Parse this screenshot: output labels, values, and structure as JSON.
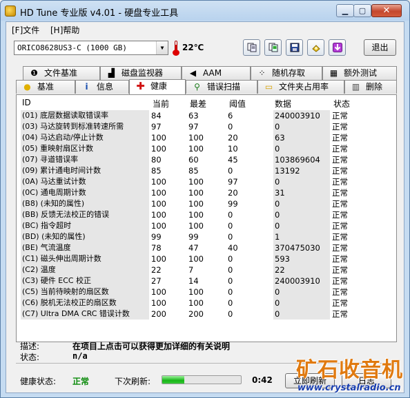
{
  "window": {
    "title": "HD Tune 专业版 v4.01 - 硬盘专业工具",
    "minimize": "▁",
    "maximize": "▢",
    "close": "✕"
  },
  "menu": {
    "file": "[F]文件",
    "help": "[H]帮助"
  },
  "toolbar": {
    "drive": "ORICO8628US3-C (1000 GB)",
    "temperature": "22℃",
    "exit_label": "退出",
    "icons": [
      "copy-text-icon",
      "copy-screen-icon",
      "save-icon",
      "options-icon",
      "download-icon"
    ]
  },
  "tabs_top": [
    {
      "label": "文件基准",
      "icon": "file-benchmark-icon",
      "glyph": "❶"
    },
    {
      "label": "磁盘监视器",
      "icon": "disk-monitor-icon",
      "glyph": "▟"
    },
    {
      "label": "AAM",
      "icon": "speaker-icon",
      "glyph": "◀"
    },
    {
      "label": "随机存取",
      "icon": "random-access-icon",
      "glyph": "⁘"
    },
    {
      "label": "额外测试",
      "icon": "extra-tests-icon",
      "glyph": "▦"
    }
  ],
  "tabs_bottom": [
    {
      "label": "基准",
      "icon": "benchmark-icon",
      "glyph": "●"
    },
    {
      "label": "信息",
      "icon": "info-icon",
      "glyph": "i"
    },
    {
      "label": "健康",
      "icon": "health-cross-icon",
      "glyph": "✚"
    },
    {
      "label": "错误扫描",
      "icon": "error-scan-icon",
      "glyph": "⚲"
    },
    {
      "label": "文件夹占用率",
      "icon": "folder-usage-icon",
      "glyph": "▭"
    },
    {
      "label": "删除",
      "icon": "erase-trash-icon",
      "glyph": "▥"
    }
  ],
  "active_tab": "健康",
  "table": {
    "headers": {
      "id": "ID",
      "current": "当前",
      "worst": "最差",
      "threshold": "阈值",
      "data": "数据",
      "status": "状态"
    },
    "rows": [
      {
        "id": "(01) 底层数据读取错误率",
        "current": "84",
        "worst": "63",
        "threshold": "6",
        "data": "240003910",
        "status": "正常"
      },
      {
        "id": "(03) 马达旋转到标准转速所需",
        "current": "97",
        "worst": "97",
        "threshold": "0",
        "data": "0",
        "status": "正常"
      },
      {
        "id": "(04) 马达启动/停止计数",
        "current": "100",
        "worst": "100",
        "threshold": "20",
        "data": "63",
        "status": "正常"
      },
      {
        "id": "(05) 重映射扇区计数",
        "current": "100",
        "worst": "100",
        "threshold": "10",
        "data": "0",
        "status": "正常"
      },
      {
        "id": "(07) 寻道错误率",
        "current": "80",
        "worst": "60",
        "threshold": "45",
        "data": "103869604",
        "status": "正常"
      },
      {
        "id": "(09) 累计通电时间计数",
        "current": "85",
        "worst": "85",
        "threshold": "0",
        "data": "13192",
        "status": "正常"
      },
      {
        "id": "(0A) 马达重试计数",
        "current": "100",
        "worst": "100",
        "threshold": "97",
        "data": "0",
        "status": "正常"
      },
      {
        "id": "(0C) 通电周期计数",
        "current": "100",
        "worst": "100",
        "threshold": "20",
        "data": "31",
        "status": "正常"
      },
      {
        "id": "(B8) (未知的属性)",
        "current": "100",
        "worst": "100",
        "threshold": "99",
        "data": "0",
        "status": "正常"
      },
      {
        "id": "(BB) 反馈无法校正的错误",
        "current": "100",
        "worst": "100",
        "threshold": "0",
        "data": "0",
        "status": "正常"
      },
      {
        "id": "(BC) 指令超时",
        "current": "100",
        "worst": "100",
        "threshold": "0",
        "data": "0",
        "status": "正常"
      },
      {
        "id": "(BD) (未知的属性)",
        "current": "99",
        "worst": "99",
        "threshold": "0",
        "data": "1",
        "status": "正常"
      },
      {
        "id": "(BE) 气流温度",
        "current": "78",
        "worst": "47",
        "threshold": "40",
        "data": "370475030",
        "status": "正常"
      },
      {
        "id": "(C1) 磁头伸出周期计数",
        "current": "100",
        "worst": "100",
        "threshold": "0",
        "data": "593",
        "status": "正常"
      },
      {
        "id": "(C2) 温度",
        "current": "22",
        "worst": "7",
        "threshold": "0",
        "data": "22",
        "status": "正常"
      },
      {
        "id": "(C3) 硬件 ECC 校正",
        "current": "27",
        "worst": "14",
        "threshold": "0",
        "data": "240003910",
        "status": "正常"
      },
      {
        "id": "(C5) 当前待映射的扇区数",
        "current": "100",
        "worst": "100",
        "threshold": "0",
        "data": "0",
        "status": "正常"
      },
      {
        "id": "(C6) 脱机无法校正的扇区数",
        "current": "100",
        "worst": "100",
        "threshold": "0",
        "data": "0",
        "status": "正常"
      },
      {
        "id": "(C7) Ultra DMA CRC 错误计数",
        "current": "200",
        "worst": "200",
        "threshold": "0",
        "data": "0",
        "status": "正常"
      }
    ]
  },
  "info": {
    "desc_label": "描述:",
    "desc_value": "在项目上点击可以获得更加详细的有关说明",
    "status_label": "状态:",
    "status_value": "n/a"
  },
  "footer": {
    "health_label": "健康状态:",
    "health_value": "正常",
    "refresh_label": "下次刷新:",
    "refresh_progress": 0.28,
    "timer": "0:42",
    "refresh_now": "立即刷新",
    "log": "日志"
  },
  "watermark": {
    "title": "矿石收音机",
    "url": "www.crystalradio.cn"
  },
  "colors": {
    "health_ok": "#0a8a0a",
    "watermark_orange": "#e07a10",
    "watermark_blue": "#1a3fb0"
  }
}
